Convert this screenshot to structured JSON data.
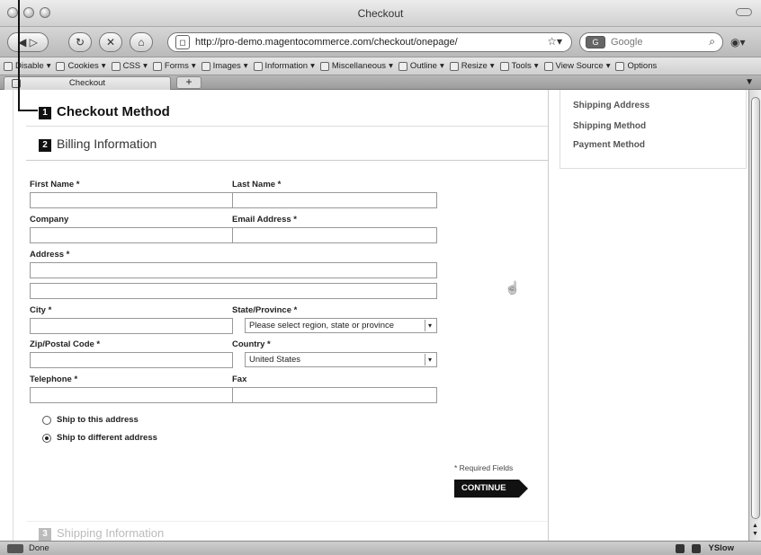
{
  "window": {
    "title": "Checkout"
  },
  "navigation": {
    "url": "http://pro-demo.magentocommerce.com/checkout/onepage/",
    "search_placeholder": "Google",
    "search_engine_badge": "G"
  },
  "toolbar": {
    "items": [
      "Disable",
      "Cookies",
      "CSS",
      "Forms",
      "Images",
      "Information",
      "Miscellaneous",
      "Outline",
      "Resize",
      "Tools",
      "View Source",
      "Options"
    ]
  },
  "tabs": {
    "active_label": "Checkout",
    "add_label": "+"
  },
  "checkout": {
    "steps": [
      {
        "number": "1",
        "title": "Checkout Method"
      },
      {
        "number": "2",
        "title": "Billing Information"
      },
      {
        "number": "3",
        "title": "Shipping Information"
      }
    ],
    "billing": {
      "first_name_label": "First Name *",
      "last_name_label": "Last Name *",
      "company_label": "Company",
      "email_label": "Email Address *",
      "address_label": "Address *",
      "city_label": "City *",
      "state_label": "State/Province *",
      "state_value": "Please select region, state or province",
      "zip_label": "Zip/Postal Code *",
      "country_label": "Country *",
      "country_value": "United States",
      "telephone_label": "Telephone *",
      "fax_label": "Fax"
    },
    "ship_options": [
      {
        "label": "Ship to this address",
        "checked": false
      },
      {
        "label": "Ship to different address",
        "checked": true
      }
    ],
    "required_note": "* Required Fields",
    "continue_label": "CONTINUE"
  },
  "sidebar": {
    "progress_items": [
      "Shipping Address",
      "Shipping Method",
      "Payment Method"
    ]
  },
  "status": {
    "text": "Done",
    "right_label": "YSlow"
  }
}
